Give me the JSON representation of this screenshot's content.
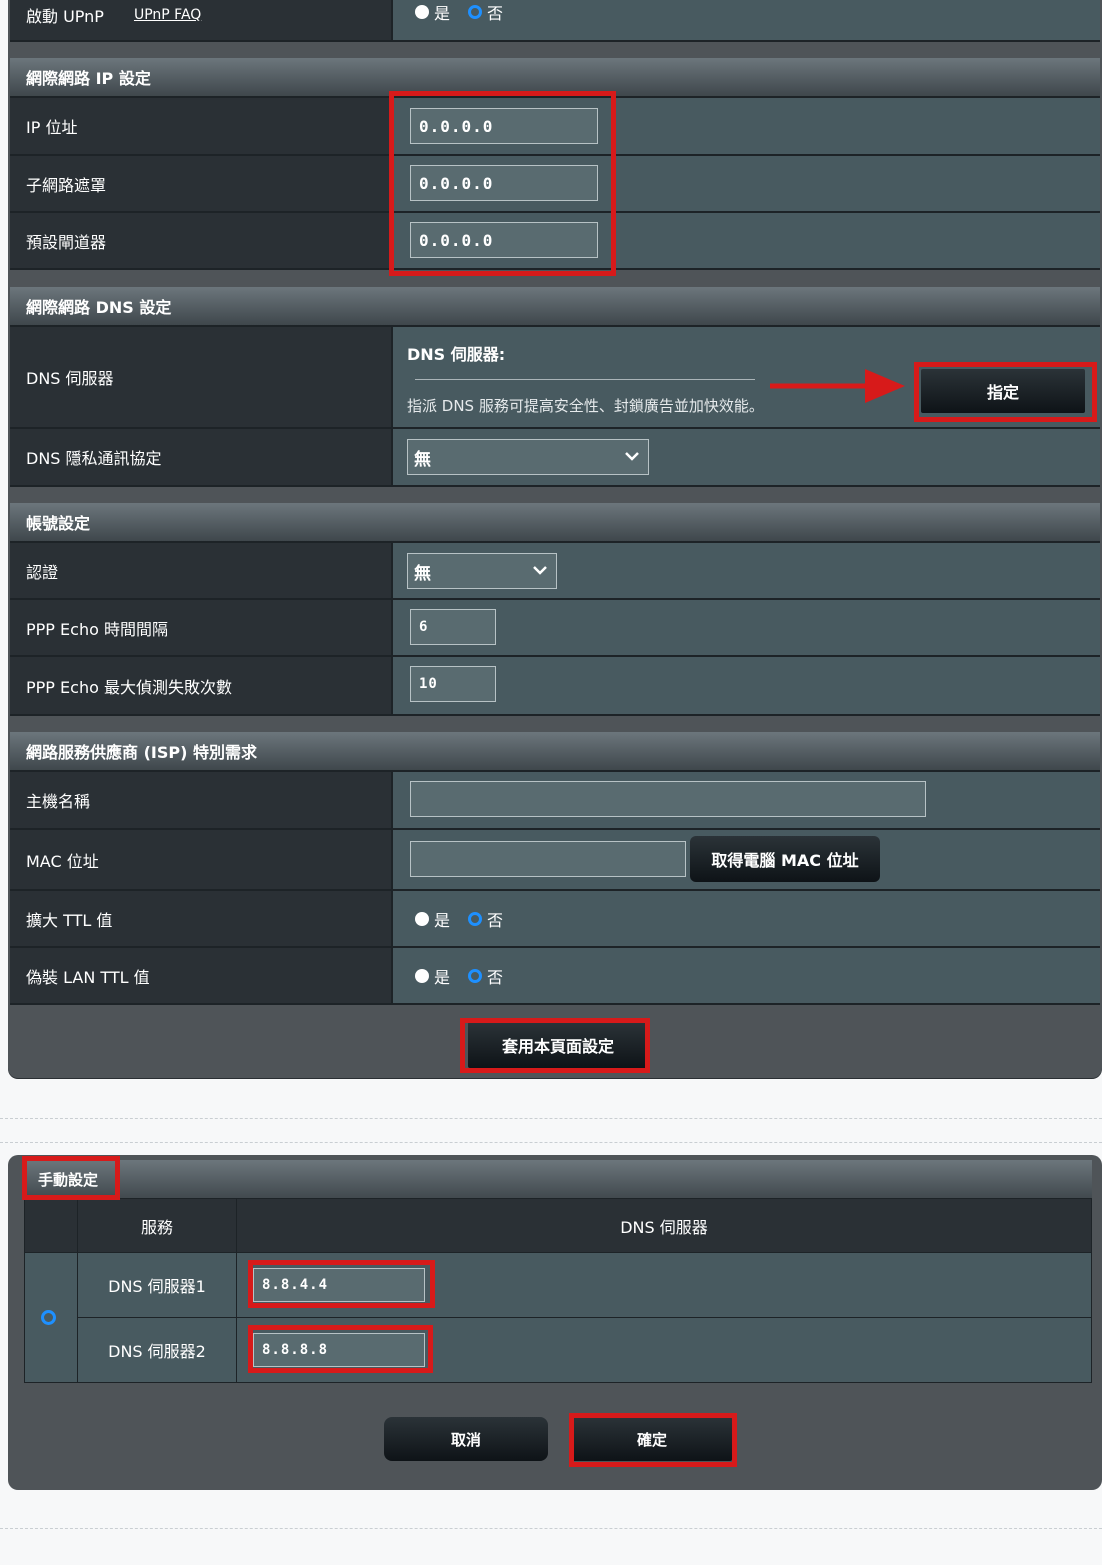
{
  "upnp": {
    "label": "啟動 UPnP",
    "faq_link": "UPnP FAQ",
    "yes": "是",
    "no": "否"
  },
  "wan_ip": {
    "section_title": "網際網路 IP 設定",
    "ip_label": "IP 位址",
    "ip_value": "0.0.0.0",
    "mask_label": "子網路遮罩",
    "mask_value": "0.0.0.0",
    "gateway_label": "預設閘道器",
    "gateway_value": "0.0.0.0"
  },
  "wan_dns": {
    "section_title": "網際網路 DNS 設定",
    "dns_label": "DNS 伺服器",
    "dns_heading": "DNS 伺服器:",
    "dns_hint": "指派 DNS 服務可提高安全性、封鎖廣告並加快效能。",
    "assign_button": "指定",
    "privacy_label": "DNS 隱私通訊協定",
    "privacy_value": "無"
  },
  "account": {
    "section_title": "帳號設定",
    "auth_label": "認證",
    "auth_value": "無",
    "echo_interval_label": "PPP Echo 時間間隔",
    "echo_interval_value": "6",
    "echo_max_label": "PPP Echo 最大偵測失敗次數",
    "echo_max_value": "10"
  },
  "isp": {
    "section_title": "網路服務供應商 (ISP) 特別需求",
    "hostname_label": "主機名稱",
    "hostname_value": "",
    "mac_label": "MAC 位址",
    "mac_value": "",
    "mac_button": "取得電腦 MAC 位址",
    "ttl_label": "擴大 TTL 值",
    "spoof_ttl_label": "偽裝 LAN TTL 值",
    "yes": "是",
    "no": "否"
  },
  "apply_button": "套用本頁面設定",
  "manual": {
    "title": "手動設定",
    "col_service": "服務",
    "col_dns": "DNS 伺服器",
    "dns1_label": "DNS 伺服器1",
    "dns1_value": "8.8.4.4",
    "dns2_label": "DNS 伺服器2",
    "dns2_value": "8.8.8.8",
    "cancel_button": "取消",
    "ok_button": "確定"
  },
  "colors": {
    "highlight": "#d71a1a",
    "radio_accent": "#1e90ff"
  }
}
